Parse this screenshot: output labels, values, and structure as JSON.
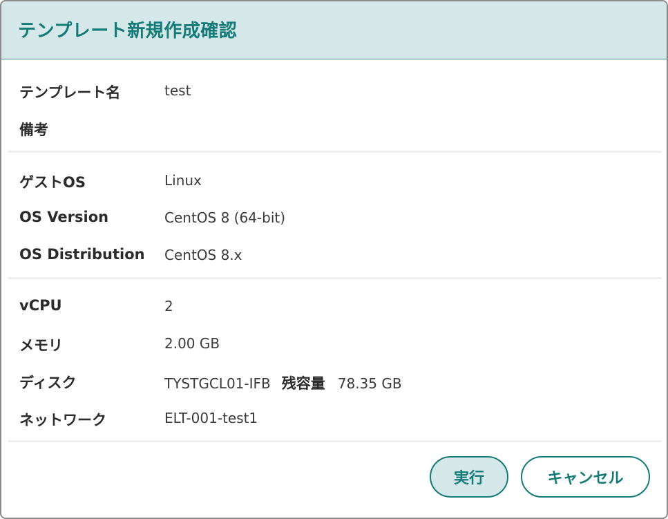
{
  "dialog": {
    "title": "テンプレート新規作成確認"
  },
  "template_section": {
    "name_label": "テンプレート名",
    "name_value": "test",
    "note_label": "備考",
    "note_value": ""
  },
  "os_section": {
    "guest_os_label": "ゲストOS",
    "guest_os_value": "Linux",
    "os_version_label": "OS Version",
    "os_version_value": "CentOS 8 (64-bit)",
    "os_distribution_label": "OS Distribution",
    "os_distribution_value": "CentOS 8.x"
  },
  "resource_section": {
    "vcpu_label": "vCPU",
    "vcpu_value": "2",
    "memory_label": "メモリ",
    "memory_value": "2.00 GB",
    "disk_label": "ディスク",
    "disk_value": "TYSTGCL01-IFB",
    "disk_remaining_label": "残容量",
    "disk_remaining_value": "78.35 GB",
    "network_label": "ネットワーク",
    "network_value": "ELT-001-test1"
  },
  "actions": {
    "execute_label": "実行",
    "cancel_label": "キャンセル"
  }
}
